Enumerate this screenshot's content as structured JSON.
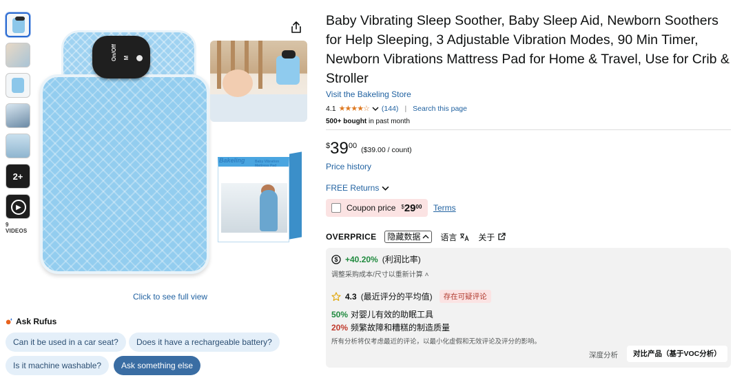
{
  "thumbnails": {
    "more_count": "2+",
    "videos_label": "9 VIDEOS"
  },
  "product_image": {
    "controller_left_label": "On/Off",
    "controller_mid_label": "M",
    "box_brand": "Bakeling",
    "box_title": "Baby Vibration Mattress Pad"
  },
  "image_link": "Click to see full view",
  "rufus": {
    "title": "Ask Rufus",
    "chips": [
      "Can it be used in a car seat?",
      "Does it have a rechargeable battery?",
      "Is it machine washable?",
      "Ask something else"
    ]
  },
  "product": {
    "title": "Baby Vibrating Sleep Soother, Baby Sleep Aid, Newborn Soothers for Help Sleeping, 3 Adjustable Vibration Modes, 90 Min Timer, Newborn Vibrations Mattress Pad for Home & Travel, Use for Crib & Stroller",
    "store_link": "Visit the Bakeling Store",
    "rating": "4.1",
    "rating_stars": 4.1,
    "review_count": "(144)",
    "search_page": "Search this page",
    "bought_bold": "500+ bought",
    "bought_rest": " in past month"
  },
  "price": {
    "symbol": "$",
    "whole": "39",
    "fraction": "00",
    "unit": "($39.00 / count)",
    "history": "Price history",
    "returns": "FREE Returns"
  },
  "coupon": {
    "label": "Coupon price",
    "symbol": "$",
    "whole": "29",
    "fraction": "00",
    "terms": "Terms"
  },
  "overprice": {
    "brand": "OVERPRICE",
    "hide_toggle": "隐藏数据",
    "language": "语言",
    "about": "关于",
    "profit_value": "+40.20%",
    "profit_label": "(利润比率)",
    "recalc": "调整采购成本/尺寸以重新计算",
    "review_score": "4.3",
    "review_label": "(最近评分的平均值)",
    "review_badge": "存在可疑评论",
    "stat1_pct": "50%",
    "stat1_text": "对婴儿有效的助眠工具",
    "stat2_pct": "20%",
    "stat2_text": "频繁故障和糟糕的制造质量",
    "note": "所有分析将仅考虑最近的评论，以最小化虚假和无效评论及评分的影响。",
    "deep_analysis": "深度分析",
    "compare_button": "对比产品（基于VOC分析）"
  },
  "colors": {
    "link": "#2162a1",
    "star": "#de7921",
    "profit_green": "#1f8a3e",
    "alert_red": "#c0392b",
    "pad_blue": "#93cdef"
  }
}
